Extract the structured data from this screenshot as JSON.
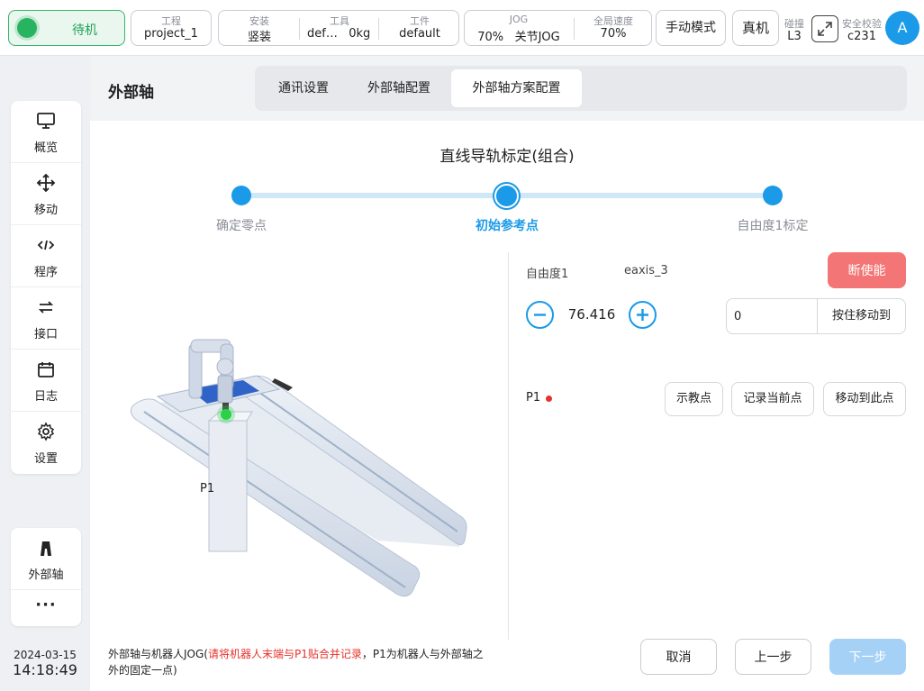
{
  "status": {
    "label": "待机"
  },
  "project": {
    "key": "工程",
    "value": "project_1"
  },
  "mount": {
    "key": "安装",
    "value": "竖装"
  },
  "tool": {
    "key": "工具",
    "value": "def…",
    "extra": "0kg"
  },
  "workpiece": {
    "key": "工件",
    "value": "default"
  },
  "jog": {
    "key": "JOG",
    "value": "70%",
    "mode": "关节JOG"
  },
  "global_speed": {
    "key": "全局速度",
    "value": "70%"
  },
  "manual_mode_label": "手动模式",
  "real_robot_label": "真机",
  "collision": {
    "key": "碰撞",
    "value": "L3"
  },
  "safety": {
    "key": "安全校验",
    "value": "c231"
  },
  "avatar": "A",
  "sidebar": {
    "items": [
      {
        "label": "概览",
        "icon": "monitor-icon"
      },
      {
        "label": "移动",
        "icon": "move-icon"
      },
      {
        "label": "程序",
        "icon": "code-icon"
      },
      {
        "label": "接口",
        "icon": "swap-icon"
      },
      {
        "label": "日志",
        "icon": "calendar-icon"
      },
      {
        "label": "设置",
        "icon": "gear-icon"
      }
    ]
  },
  "sidebar2": {
    "items": [
      {
        "label": "外部轴",
        "icon": "external-axis-icon"
      },
      {
        "label": "···",
        "icon": "more-icon"
      }
    ]
  },
  "datetime": {
    "date": "2024-03-15",
    "time": "14:18:49"
  },
  "page": {
    "title": "外部轴"
  },
  "tabs": [
    "通讯设置",
    "外部轴配置",
    "外部轴方案配置"
  ],
  "wizard": {
    "title": "直线导轨标定(组合)",
    "steps": [
      "确定零点",
      "初始参考点",
      "自由度1标定"
    ],
    "active_step": 1
  },
  "image": {
    "point_label": "P1"
  },
  "dof": {
    "label": "自由度1",
    "axis": "eaxis_3",
    "value": "76.416",
    "disable_label": "断使能",
    "target_value": "0",
    "move_to_label": "按住移动到"
  },
  "point": {
    "label": "P1",
    "teach_label": "示教点",
    "record_label": "记录当前点",
    "move_here_label": "移动到此点"
  },
  "note": {
    "prefix": "外部轴与机器人JOG(",
    "highlight": "请将机器人末端与P1贴合并记录",
    "suffix": "，P1为机器人与外部轴之外的固定一点)"
  },
  "footer": {
    "cancel": "取消",
    "prev": "上一步",
    "next": "下一步"
  },
  "colors": {
    "accent": "#1a9ae8",
    "success": "#27b35f",
    "danger": "#f47575",
    "next_disabled": "#a5d1f7"
  }
}
